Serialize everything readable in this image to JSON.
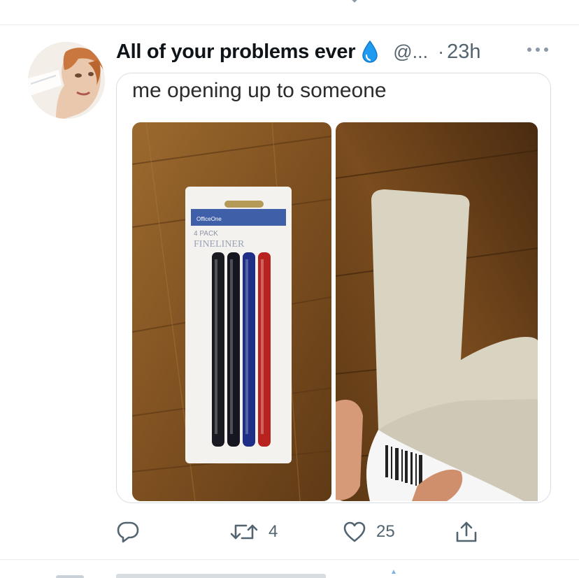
{
  "tweet": {
    "display_name": "All of your problems ever",
    "verified_icon": "droplet-icon",
    "handle": "@...",
    "separator": "·",
    "time": "23h",
    "more_icon": "more-icon",
    "media": {
      "caption": "me opening up to someone",
      "left_panel": {
        "brand": "OfficeOne",
        "pack": "4 PACK",
        "product": "FINELINER"
      }
    },
    "actions": {
      "reply_icon": "reply-icon",
      "retweet_icon": "retweet-icon",
      "retweet_count": "4",
      "like_icon": "heart-icon",
      "like_count": "25",
      "share_icon": "share-icon"
    }
  },
  "colors": {
    "text_primary": "#0f1419",
    "text_secondary": "#536471",
    "border": "#e6ecf0",
    "droplet": "#1d9bf0"
  }
}
